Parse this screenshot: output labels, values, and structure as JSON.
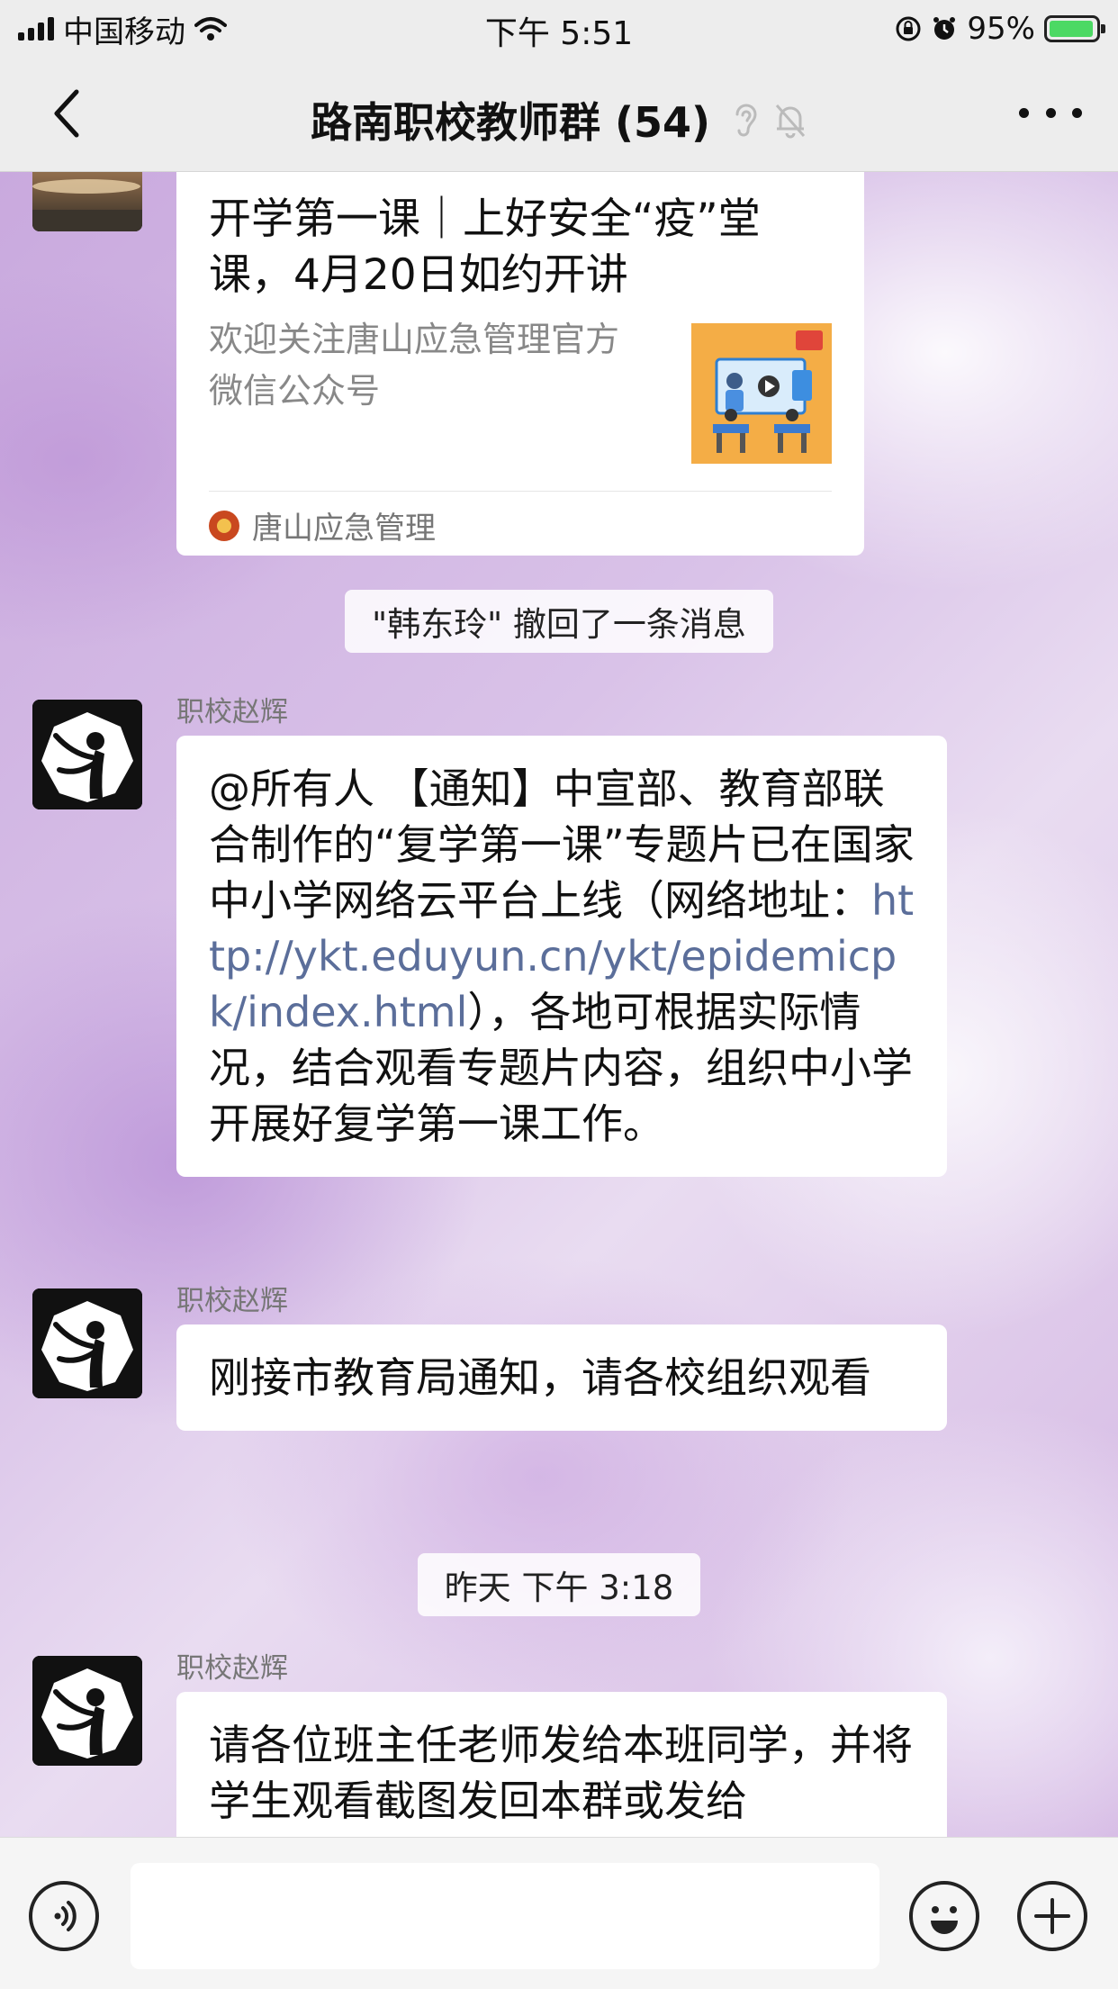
{
  "status_bar": {
    "carrier": "中国移动",
    "time": "下午 5:51",
    "battery": "95%",
    "battery_level": 0.95
  },
  "header": {
    "title": "路南职校教师群 (54)"
  },
  "messages": {
    "article": {
      "title": "开学第一课｜上好安全“疫”堂课，4月20日如约开讲",
      "description": "欢迎关注唐山应急管理官方微信公众号",
      "source": "唐山应急管理"
    },
    "recall_notice": "\"韩东玲\" 撤回了一条消息",
    "msg1": {
      "sender": "职校赵辉",
      "text_before": "@所有人 【通知】中宣部、教育部联合制作的“复学第一课”专题片已在国家中小学网络云平台上线（网络地址：",
      "link": "http://ykt.eduyun.cn/ykt/epidemicpk/index.html",
      "text_after": "），各地可根据实际情况，结合观看专题片内容，组织中小学开展好复学第一课工作。"
    },
    "msg2": {
      "sender": "职校赵辉",
      "text": "刚接市教育局通知，请各校组织观看"
    },
    "timestamp": "昨天 下午 3:18",
    "msg3": {
      "sender": "职校赵辉",
      "text": "请各位班主任老师发给本班同学，并将学生观看截图发回本群或发给"
    }
  },
  "input_bar": {
    "message_value": ""
  },
  "icons": {
    "back": "chevron-left-icon",
    "ear": "ear-icon",
    "mute": "bell-slash-icon",
    "more": "more-dots-icon",
    "voice": "voice-icon",
    "emoji": "emoji-icon",
    "add": "plus-icon"
  }
}
